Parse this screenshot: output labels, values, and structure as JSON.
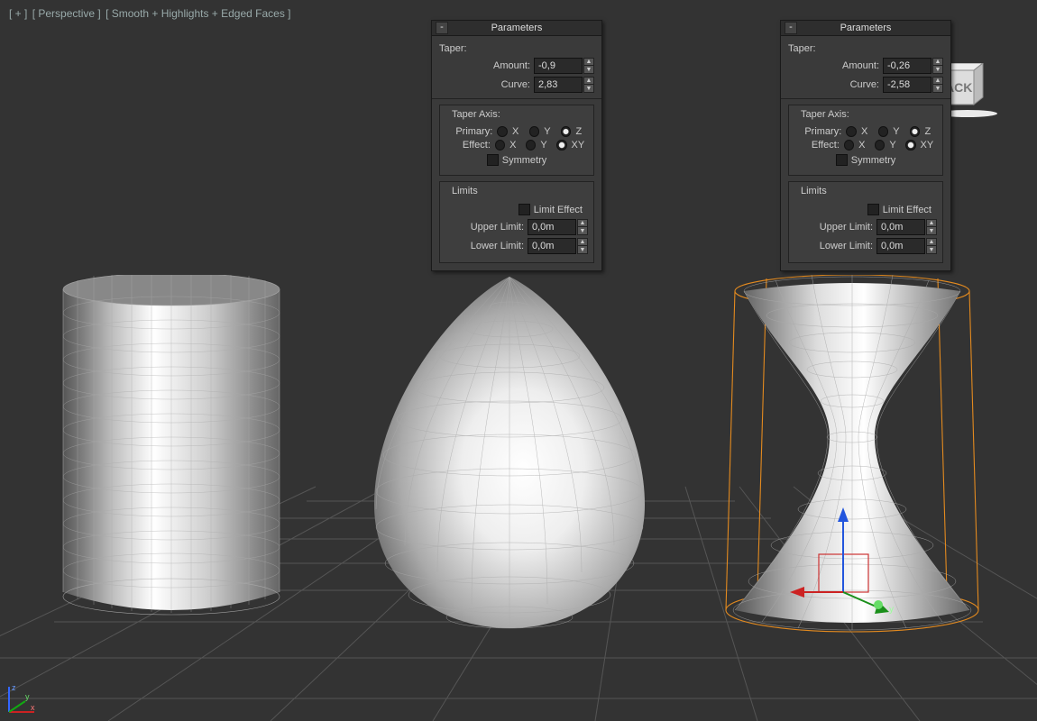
{
  "viewportLabel": {
    "plus": "[ + ]",
    "view": "[ Perspective ]",
    "shading": "[ Smooth + Highlights + Edged Faces ]"
  },
  "panels": [
    {
      "title": "Parameters",
      "taper": {
        "label": "Taper:",
        "amountLabel": "Amount:",
        "amount": "-0,9",
        "curveLabel": "Curve:",
        "curve": "2,83"
      },
      "axis": {
        "label": "Taper Axis:",
        "primaryLabel": "Primary:",
        "effectLabel": "Effect:",
        "x": "X",
        "y": "Y",
        "z": "Z",
        "xy": "XY",
        "primarySel": "Z",
        "effectSel": "XY",
        "symmetryLabel": "Symmetry"
      },
      "limits": {
        "label": "Limits",
        "limitEffectLabel": "Limit Effect",
        "upperLabel": "Upper Limit:",
        "upper": "0,0m",
        "lowerLabel": "Lower Limit:",
        "lower": "0,0m"
      }
    },
    {
      "title": "Parameters",
      "taper": {
        "label": "Taper:",
        "amountLabel": "Amount:",
        "amount": "-0,26",
        "curveLabel": "Curve:",
        "curve": "-2,58"
      },
      "axis": {
        "label": "Taper Axis:",
        "primaryLabel": "Primary:",
        "effectLabel": "Effect:",
        "x": "X",
        "y": "Y",
        "z": "Z",
        "xy": "XY",
        "primarySel": "Z",
        "effectSel": "XY",
        "symmetryLabel": "Symmetry"
      },
      "limits": {
        "label": "Limits",
        "limitEffectLabel": "Limit Effect",
        "upperLabel": "Upper Limit:",
        "upper": "0,0m",
        "lowerLabel": "Lower Limit:",
        "lower": "0,0m"
      }
    }
  ],
  "watermark": {
    "text": "ACK"
  },
  "gizmoLabels": {
    "x": "x",
    "y": "y",
    "z": "z"
  }
}
